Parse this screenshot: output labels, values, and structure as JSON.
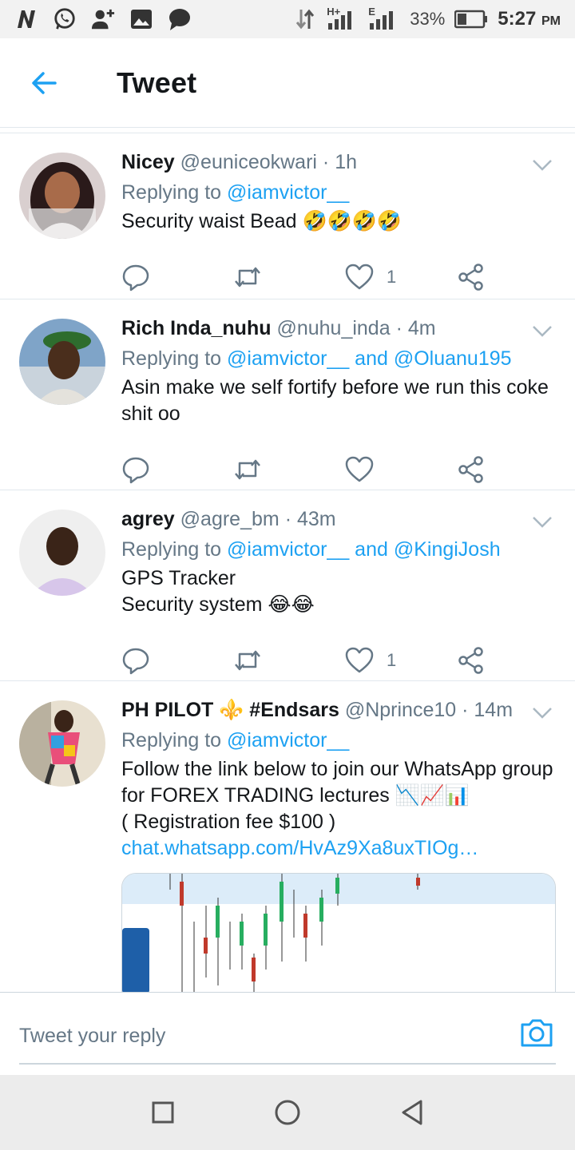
{
  "status_bar": {
    "battery": "33%",
    "time": "5:27",
    "ampm": "PM",
    "network_1": "H+",
    "network_2": "E",
    "icons": [
      "n-app-icon",
      "whatsapp-icon",
      "add-contact-icon",
      "gallery-icon",
      "message-icon",
      "data-arrows-icon",
      "signal-icon",
      "signal-icon",
      "battery-icon"
    ]
  },
  "header": {
    "title": "Tweet",
    "back_icon": "back-arrow-icon"
  },
  "colors": {
    "accent": "#1da1f2",
    "secondary_text": "#657786",
    "divider": "#e1e8ed"
  },
  "tweets": [
    {
      "name": "Nicey",
      "handle": "@euniceokwari",
      "dot": "·",
      "time": "1h",
      "replying_prefix": "Replying to",
      "mentions": "@iamvictor__",
      "text": "Security waist Bead 🤣🤣🤣🤣",
      "likes": "1"
    },
    {
      "name": "Rich Inda_nuhu",
      "handle": "@nuhu_inda",
      "dot": "·",
      "time": "4m",
      "replying_prefix": "Replying to",
      "mentions": "@iamvictor__ and @Oluanu195",
      "text": "Asin make we self fortify before we run this coke shit oo",
      "likes": ""
    },
    {
      "name": "agrey",
      "handle": "@agre_bm",
      "dot": "·",
      "time": "43m",
      "replying_prefix": "Replying to",
      "mentions": "@iamvictor__ and @KingiJosh",
      "text_line1": "GPS Tracker",
      "text_line2": "Security system 😂😂",
      "likes": "1"
    },
    {
      "name": "PH PILOT ⚜️ #Endsars",
      "handle": "@Nprince10",
      "dot": "·",
      "time": "14m",
      "replying_prefix": "Replying to",
      "mentions": "@iamvictor__",
      "text_line1": "Follow the link below to join our WhatsApp group for FOREX TRADING lectures 📉📈📊",
      "text_line2": "( Registration fee $100 )",
      "link": "chat.whatsapp.com/HvAz9Xa8uxTIOg…"
    }
  ],
  "reply_bar": {
    "placeholder": "Tweet your reply",
    "camera_icon": "camera-icon"
  },
  "nav_bar": {
    "icons": [
      "recents-square-icon",
      "home-circle-icon",
      "back-triangle-icon"
    ]
  }
}
